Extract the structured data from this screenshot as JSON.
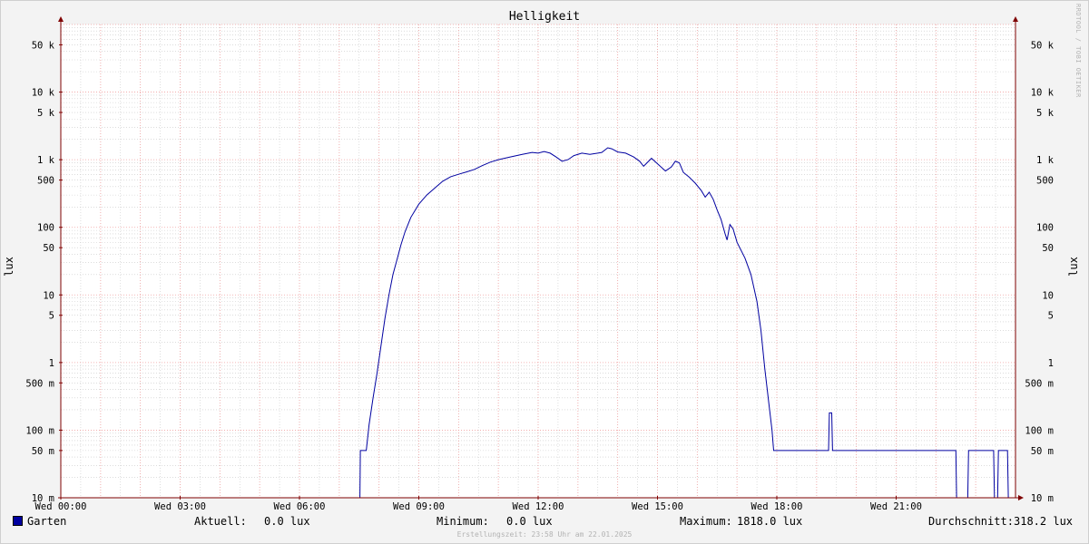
{
  "watermark": "RRDTOOL / TOBI OETIKER",
  "chart_data": {
    "type": "line",
    "title": "Helligkeit",
    "ylabel": "lux",
    "yscale": "log",
    "ylim": [
      0.01,
      100000
    ],
    "xlim": [
      0,
      24
    ],
    "grid": true,
    "y_ticks": [
      {
        "v": 0.01,
        "label": "10 m"
      },
      {
        "v": 0.05,
        "label": "50 m"
      },
      {
        "v": 0.1,
        "label": "100 m"
      },
      {
        "v": 0.5,
        "label": "500 m"
      },
      {
        "v": 1,
        "label": "1"
      },
      {
        "v": 5,
        "label": "5"
      },
      {
        "v": 10,
        "label": "10"
      },
      {
        "v": 50,
        "label": "50"
      },
      {
        "v": 100,
        "label": "100"
      },
      {
        "v": 500,
        "label": "500"
      },
      {
        "v": 1000,
        "label": "1 k"
      },
      {
        "v": 5000,
        "label": "5 k"
      },
      {
        "v": 10000,
        "label": "10 k"
      },
      {
        "v": 50000,
        "label": "50 k"
      }
    ],
    "x_ticks": [
      {
        "v": 0,
        "label": "Wed 00:00"
      },
      {
        "v": 3,
        "label": "Wed 03:00"
      },
      {
        "v": 6,
        "label": "Wed 06:00"
      },
      {
        "v": 9,
        "label": "Wed 09:00"
      },
      {
        "v": 12,
        "label": "Wed 12:00"
      },
      {
        "v": 15,
        "label": "Wed 15:00"
      },
      {
        "v": 18,
        "label": "Wed 18:00"
      },
      {
        "v": 21,
        "label": "Wed 21:00"
      }
    ],
    "series": [
      {
        "name": "Garten",
        "color": "#0000a0",
        "points": [
          [
            0,
            0.01
          ],
          [
            7.52,
            0.01
          ],
          [
            7.53,
            0.05
          ],
          [
            7.68,
            0.05
          ],
          [
            7.75,
            0.12
          ],
          [
            7.85,
            0.3
          ],
          [
            7.95,
            0.7
          ],
          [
            8.05,
            1.8
          ],
          [
            8.15,
            4.5
          ],
          [
            8.25,
            10
          ],
          [
            8.35,
            20
          ],
          [
            8.45,
            33
          ],
          [
            8.55,
            55
          ],
          [
            8.65,
            85
          ],
          [
            8.8,
            140
          ],
          [
            9.0,
            220
          ],
          [
            9.2,
            300
          ],
          [
            9.4,
            380
          ],
          [
            9.6,
            480
          ],
          [
            9.8,
            560
          ],
          [
            10.0,
            610
          ],
          [
            10.2,
            660
          ],
          [
            10.4,
            720
          ],
          [
            10.6,
            820
          ],
          [
            10.8,
            920
          ],
          [
            11.0,
            1000
          ],
          [
            11.3,
            1100
          ],
          [
            11.6,
            1200
          ],
          [
            11.85,
            1280
          ],
          [
            12.0,
            1250
          ],
          [
            12.15,
            1320
          ],
          [
            12.3,
            1250
          ],
          [
            12.45,
            1100
          ],
          [
            12.6,
            950
          ],
          [
            12.75,
            1000
          ],
          [
            12.9,
            1150
          ],
          [
            13.1,
            1250
          ],
          [
            13.3,
            1200
          ],
          [
            13.5,
            1250
          ],
          [
            13.6,
            1280
          ],
          [
            13.75,
            1500
          ],
          [
            13.85,
            1450
          ],
          [
            14.0,
            1300
          ],
          [
            14.2,
            1250
          ],
          [
            14.4,
            1100
          ],
          [
            14.55,
            950
          ],
          [
            14.65,
            800
          ],
          [
            14.85,
            1050
          ],
          [
            15.05,
            820
          ],
          [
            15.2,
            680
          ],
          [
            15.35,
            780
          ],
          [
            15.45,
            950
          ],
          [
            15.55,
            900
          ],
          [
            15.65,
            650
          ],
          [
            15.8,
            550
          ],
          [
            15.95,
            450
          ],
          [
            16.1,
            350
          ],
          [
            16.2,
            280
          ],
          [
            16.3,
            330
          ],
          [
            16.4,
            260
          ],
          [
            16.5,
            180
          ],
          [
            16.6,
            130
          ],
          [
            16.7,
            80
          ],
          [
            16.75,
            65
          ],
          [
            16.82,
            110
          ],
          [
            16.9,
            95
          ],
          [
            17.0,
            60
          ],
          [
            17.2,
            35
          ],
          [
            17.35,
            20
          ],
          [
            17.5,
            8
          ],
          [
            17.6,
            3
          ],
          [
            17.7,
            0.8
          ],
          [
            17.8,
            0.25
          ],
          [
            17.88,
            0.1
          ],
          [
            17.92,
            0.05
          ],
          [
            19.3,
            0.05
          ],
          [
            19.32,
            0.18
          ],
          [
            19.38,
            0.18
          ],
          [
            19.4,
            0.05
          ],
          [
            22.5,
            0.05
          ],
          [
            22.52,
            0.01
          ],
          [
            22.8,
            0.01
          ],
          [
            22.82,
            0.05
          ],
          [
            23.45,
            0.05
          ],
          [
            23.47,
            0.01
          ],
          [
            23.55,
            0.01
          ],
          [
            23.57,
            0.05
          ],
          [
            23.8,
            0.05
          ],
          [
            23.82,
            0.01
          ],
          [
            24,
            0.01
          ]
        ]
      }
    ],
    "legend": {
      "aktuell_label": "Aktuell:",
      "aktuell_value": "0.0 lux",
      "minimum_label": "Minimum:",
      "minimum_value": "0.0 lux",
      "maximum_label": "Maximum:",
      "maximum_value": "1818.0 lux",
      "durchschnitt_label": "Durchschnitt:",
      "durchschnitt_value": "318.2 lux"
    },
    "footer": "Erstellungszeit: 23:58 Uhr am 22.01.2025",
    "colors": {
      "major_grid": "#f0a0a0",
      "minor_grid": "#c8c8c8",
      "axis": "#7f0000",
      "plot_bg": "#ffffff"
    }
  }
}
